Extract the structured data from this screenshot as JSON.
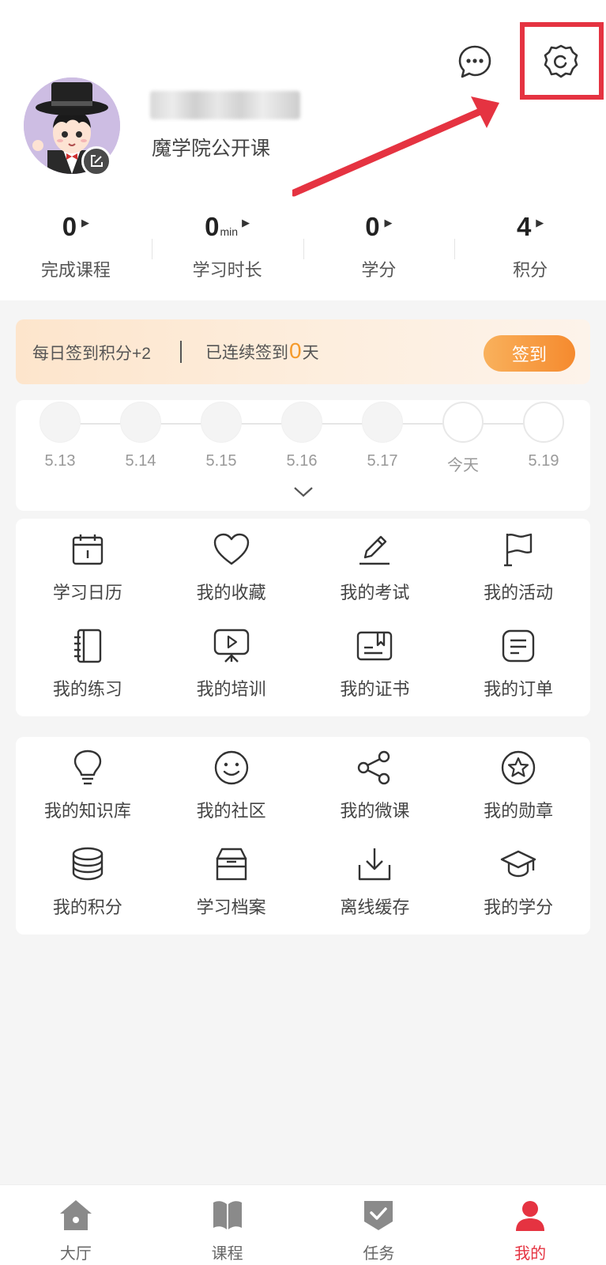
{
  "profile": {
    "org_name": "魔学院公开课"
  },
  "colors": {
    "accent": "#e53341",
    "checkin_orange": "#f58a2e",
    "annotation_red": "#e53341"
  },
  "stats": [
    {
      "value": "0",
      "unit": "",
      "label": "完成课程"
    },
    {
      "value": "0",
      "unit": "min",
      "label": "学习时长"
    },
    {
      "value": "0",
      "unit": "",
      "label": "学分"
    },
    {
      "value": "4",
      "unit": "",
      "label": "积分"
    }
  ],
  "checkin": {
    "reward_text": "每日签到积分+2",
    "streak_prefix": "已连续签到",
    "streak_count": "0",
    "streak_suffix": "天",
    "button_label": "签到"
  },
  "timeline": {
    "days": [
      {
        "label": "5.13",
        "state": "past"
      },
      {
        "label": "5.14",
        "state": "past"
      },
      {
        "label": "5.15",
        "state": "past"
      },
      {
        "label": "5.16",
        "state": "past"
      },
      {
        "label": "5.17",
        "state": "past"
      },
      {
        "label": "今天",
        "state": "today"
      },
      {
        "label": "5.19",
        "state": "future"
      }
    ]
  },
  "grid1": {
    "items": [
      {
        "label": "学习日历",
        "icon": "calendar-icon"
      },
      {
        "label": "我的收藏",
        "icon": "heart-icon"
      },
      {
        "label": "我的考试",
        "icon": "pencil-icon"
      },
      {
        "label": "我的活动",
        "icon": "flag-icon"
      },
      {
        "label": "我的练习",
        "icon": "notebook-icon"
      },
      {
        "label": "我的培训",
        "icon": "presentation-icon"
      },
      {
        "label": "我的证书",
        "icon": "certificate-icon"
      },
      {
        "label": "我的订单",
        "icon": "order-list-icon"
      }
    ]
  },
  "grid2": {
    "items": [
      {
        "label": "我的知识库",
        "icon": "lightbulb-icon"
      },
      {
        "label": "我的社区",
        "icon": "smiley-icon"
      },
      {
        "label": "我的微课",
        "icon": "share-icon"
      },
      {
        "label": "我的勋章",
        "icon": "star-medal-icon"
      },
      {
        "label": "我的积分",
        "icon": "coin-stack-icon"
      },
      {
        "label": "学习档案",
        "icon": "archive-box-icon"
      },
      {
        "label": "离线缓存",
        "icon": "download-icon"
      },
      {
        "label": "我的学分",
        "icon": "graduation-cap-icon"
      }
    ]
  },
  "tabbar": {
    "items": [
      {
        "label": "大厅",
        "icon": "home-icon"
      },
      {
        "label": "课程",
        "icon": "book-icon"
      },
      {
        "label": "任务",
        "icon": "task-shield-icon"
      },
      {
        "label": "我的",
        "icon": "profile-icon",
        "active": true
      }
    ]
  }
}
